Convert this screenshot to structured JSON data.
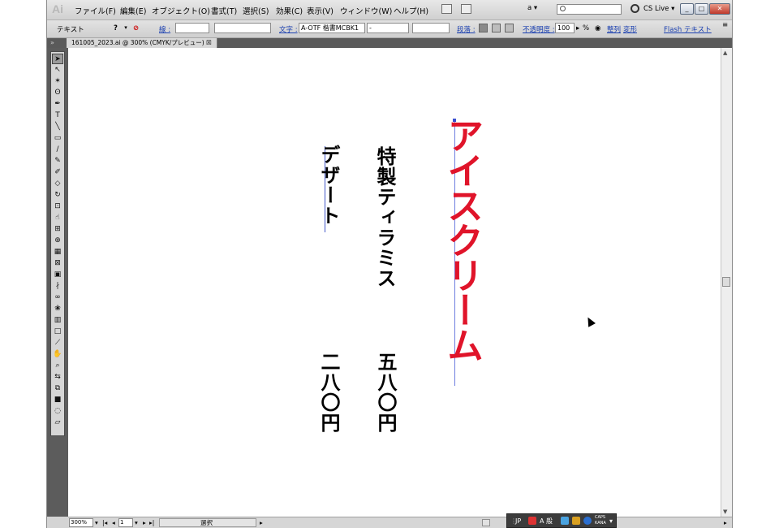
{
  "app": {
    "logo_text": "Ai"
  },
  "menu": {
    "items": [
      "ファイル(F)",
      "編集(E)",
      "オブジェクト(O)",
      "書式(T)",
      "選択(S)",
      "効果(C)",
      "表示(V)",
      "ウィンドウ(W)",
      "ヘルプ(H)"
    ],
    "workspace_value": "a ▾",
    "search_placeholder": "",
    "cs_live": "CS Live ▾"
  },
  "control_bar": {
    "mode_label": "テキスト",
    "stroke_label": "線 :",
    "font_label": "文字 :",
    "font_value": "A-OTF 楷書MCBK1",
    "style_value": "-",
    "paragraph_label": "段落 :",
    "opacity_label": "不透明度 :",
    "opacity_value": "100",
    "opacity_unit": "%",
    "align_label": "整列",
    "transform_label": "変形",
    "flash_text_label": "Flash テキスト",
    "fill_question": "?"
  },
  "document": {
    "tab_title": "161005_2023.ai @ 300% (CMYK/プレビュー)",
    "close_glyph": "☒",
    "collapse_glyph": "»"
  },
  "artwork": {
    "title": "アイスクリーム",
    "title_color": "#e0142a",
    "item1_name": "特製ティラミス",
    "item1_price": "五八〇円",
    "item2_name": "デザート",
    "item2_price": "二八〇円"
  },
  "status_bar": {
    "zoom": "300%",
    "page": "1",
    "status": "選択"
  },
  "language_bar": {
    "lang": "JP",
    "ime_mode": "A 般",
    "caps": "CAPS",
    "kana": "KANA"
  },
  "tools": [
    "selection",
    "direct-selection",
    "magic-wand",
    "lasso",
    "pen",
    "type",
    "line",
    "rectangle",
    "paintbrush",
    "pencil",
    "blob-brush",
    "eraser",
    "rotate",
    "scale",
    "warp",
    "free-transform",
    "shape-builder",
    "perspective-grid",
    "mesh",
    "gradient",
    "eyedropper",
    "blend",
    "symbol-sprayer",
    "column-graph",
    "artboard",
    "slice",
    "hand",
    "zoom",
    "swap-colors",
    "fill-stroke",
    "color-mode",
    "draw-mode",
    "screen-mode"
  ]
}
